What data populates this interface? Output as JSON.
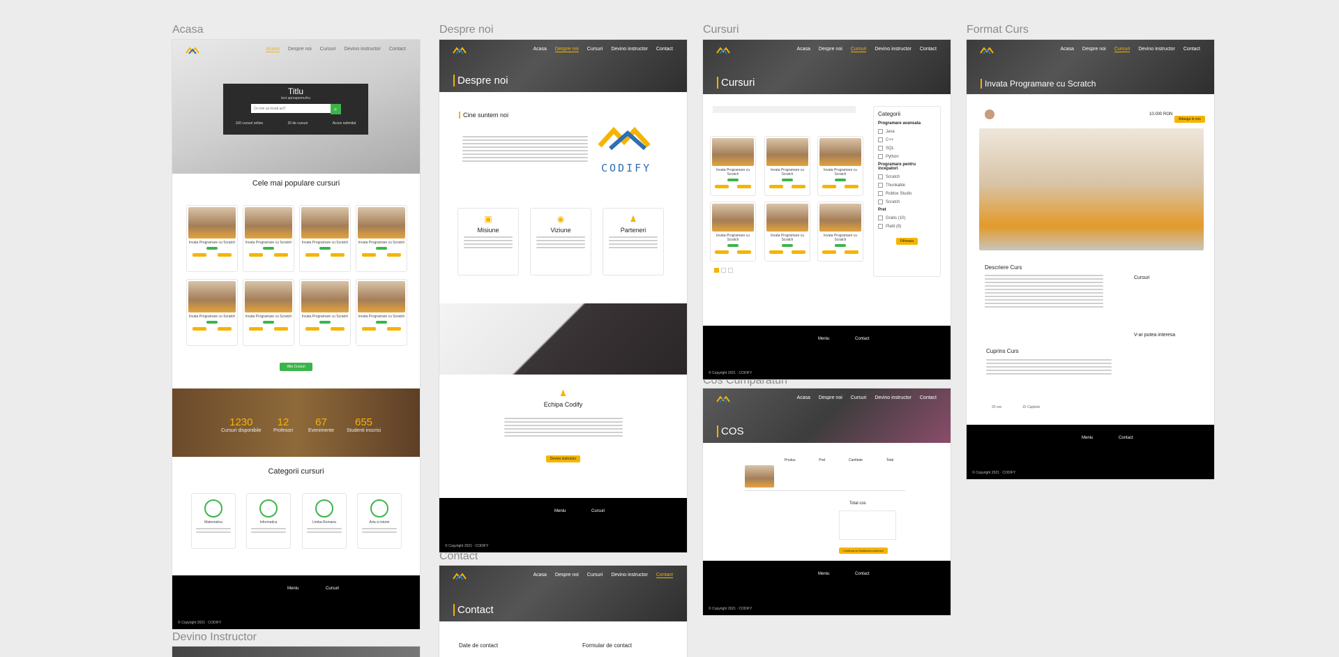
{
  "frames": {
    "acasa": "Acasa",
    "despre": "Despre noi",
    "cursuri": "Cursuri",
    "format": "Format Curs",
    "cos": "Cos Cumparaturi",
    "contact": "Contact",
    "devino": "Devino Instructor"
  },
  "acasa": {
    "hero_title": "Titlu",
    "hero_subtitle": "text aproapemurhu",
    "search_placeholder": "Ce vrei sa invati azi?",
    "hero_stats": [
      "100 cursuri online",
      "20 de cursuri",
      "Acces nelimitat"
    ],
    "popular_title": "Cele mai populare cursuri",
    "course_name": "Invata Programare cu Scratch",
    "course_cta": "Afla Cursuri",
    "stats": [
      {
        "n": "1230",
        "l": "Cursuri disponibile"
      },
      {
        "n": "12",
        "l": "Profesori"
      },
      {
        "n": "67",
        "l": "Evenimente"
      },
      {
        "n": "655",
        "l": "Studenti inscrisi"
      }
    ],
    "categories_title": "Categorii cursuri",
    "categories": [
      "Matematica",
      "Informatica",
      "Limba Romana",
      "Arta si istorie"
    ]
  },
  "despre": {
    "hero_title": "Despre noi",
    "who_title": "Cine suntem noi",
    "brand": "CODIFY",
    "cards": [
      "Misiune",
      "Viziune",
      "Parteneri"
    ],
    "team_title": "Echipa Codify",
    "team_button": "Devino instructor"
  },
  "cursuri": {
    "hero_title": "Cursuri",
    "categories_title": "Categorii",
    "group1": "Programare avansata",
    "group1_items": [
      "Java",
      "C++",
      "SQL",
      "Python"
    ],
    "group2": "Programare pentru incepatori",
    "group2_items": [
      "Scratch",
      "Thunkable",
      "Roblox Studio",
      "Scratch"
    ],
    "price_title": "Pret",
    "price_items": [
      "Gratis (10)",
      "Platit (8)"
    ],
    "filter_button": "Filtreaza"
  },
  "format": {
    "hero_title": "Invata Programare cu Scratch",
    "price": "10.000 RON",
    "buy": "Adauga in cos",
    "desc_title": "Descriere Curs",
    "contains_title": "Cuprins Curs",
    "side_title1": "Cursuri",
    "side_title2": "V-ar putea interesa",
    "meta": [
      "20 ore",
      "15 Capitole"
    ]
  },
  "cos": {
    "hero_title": "COS",
    "table_headers": [
      "Produs",
      "Pret",
      "Cantitate",
      "Total"
    ],
    "summary_title": "Total cos",
    "checkout": "Continua cu finalizarea comenzii"
  },
  "contact": {
    "hero_title": "Contact",
    "col1": "Date de contact",
    "col2": "Formular de contact"
  },
  "nav": [
    "Acasa",
    "Despre noi",
    "Cursuri",
    "Devino instructor",
    "Contact"
  ],
  "footer": {
    "menu": "Meniu",
    "courses": "Cursuri",
    "contact": "Contact",
    "copy": "© Copyright 2021 · CODIFY"
  },
  "colors": {
    "accent": "#f5b400",
    "green": "#3cb44b",
    "dark": "#000000"
  }
}
